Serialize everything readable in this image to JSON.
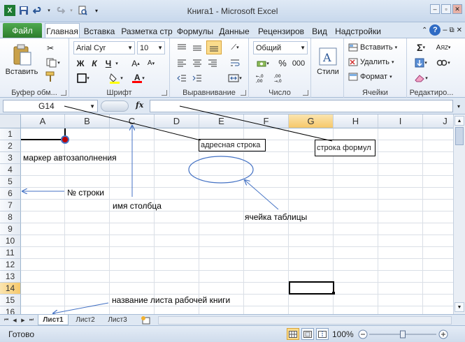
{
  "window": {
    "title": "Книга1  -  Microsoft Excel",
    "minimize_icon": "minimize-icon",
    "maximize_icon": "restore-icon",
    "close_icon": "close-icon"
  },
  "qat": {
    "icons": [
      "excel-logo-icon",
      "save-icon",
      "undo-icon",
      "redo-icon",
      "print-preview-icon",
      "customize-qat-icon"
    ]
  },
  "tabs": {
    "file": "Файл",
    "items": [
      "Главная",
      "Вставка",
      "Разметка стр",
      "Формулы",
      "Данные",
      "Рецензиров",
      "Вид",
      "Надстройки"
    ],
    "active": "Главная"
  },
  "ribbon": {
    "clipboard": {
      "label": "Буфер обм...",
      "paste": "Вставить"
    },
    "font": {
      "label": "Шрифт",
      "font_name": "Arial Cyr",
      "font_size": "10",
      "bold": "Ж",
      "italic": "К",
      "underline": "Ч",
      "highlight_color": "#ffff00",
      "font_color": "#ff0000"
    },
    "alignment": {
      "label": "Выравнивание"
    },
    "number": {
      "label": "Число",
      "format": "Общий",
      "percent": "%",
      "thousands": "000"
    },
    "styles": {
      "label": "Стили",
      "button": "Стили"
    },
    "cells": {
      "label": "Ячейки",
      "insert": "Вставить",
      "delete": "Удалить",
      "format": "Формат"
    },
    "editing": {
      "label": "Редактиро..."
    }
  },
  "formula_bar": {
    "name_box": "G14",
    "fx": "fx",
    "formula": ""
  },
  "grid": {
    "columns": [
      "A",
      "B",
      "C",
      "D",
      "E",
      "F",
      "G",
      "H",
      "I",
      "J"
    ],
    "rows": [
      "1",
      "2",
      "3",
      "4",
      "5",
      "6",
      "7",
      "8",
      "9",
      "10",
      "11",
      "12",
      "13",
      "14",
      "15",
      "16"
    ],
    "selected_column": "G",
    "selected_row": "14",
    "selected_cell": "G14"
  },
  "annotations": {
    "fill_handle": "маркер автозаполнения",
    "row_number": "№ строки",
    "column_name": "имя столбца",
    "table_cell": "ячейка таблицы",
    "sheet_name": "название листа рабочей книги",
    "address_bar": "адресная строка",
    "formula_bar": "строка формул"
  },
  "sheets": {
    "tabs": [
      "Лист1",
      "Лист2",
      "Лист3"
    ],
    "active": "Лист1"
  },
  "status": {
    "ready": "Готово",
    "zoom": "100%",
    "zoom_level": 1.0
  }
}
